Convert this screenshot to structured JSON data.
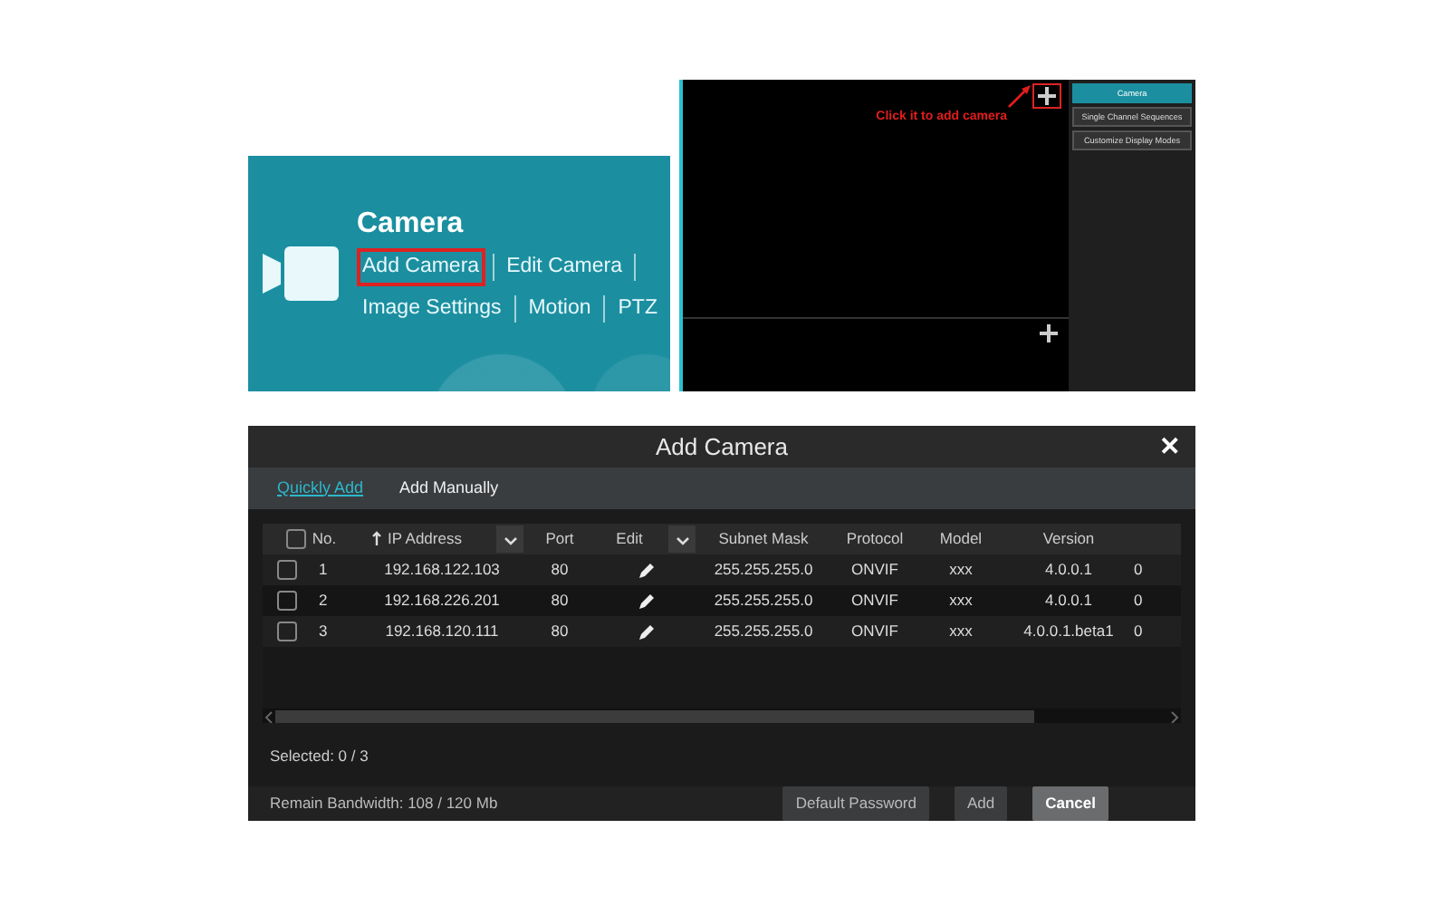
{
  "camera_tile": {
    "title": "Camera",
    "link_lines": [
      {
        "trailing_divider": true,
        "links": [
          {
            "label": "Add Camera",
            "highlighted": true
          },
          {
            "label": "Edit Camera",
            "highlighted": false
          }
        ]
      },
      {
        "trailing_divider": false,
        "links": [
          {
            "label": "Image Settings",
            "highlighted": false
          },
          {
            "label": "Motion",
            "highlighted": false
          },
          {
            "label": "PTZ",
            "highlighted": false
          }
        ]
      }
    ]
  },
  "preview": {
    "callout": "Click it to add camera",
    "sidebar": [
      {
        "label": "Camera",
        "selected": true
      },
      {
        "label": "Single Channel Sequences",
        "selected": false
      },
      {
        "label": "Customize Display Modes",
        "selected": false
      }
    ]
  },
  "dialog": {
    "title": "Add Camera",
    "close": "✕",
    "tabs": [
      {
        "label": "Quickly Add",
        "selected": true
      },
      {
        "label": "Add Manually",
        "selected": false
      }
    ],
    "table": {
      "select_all_checked": false,
      "columns": [
        {
          "label": "No.",
          "kind": "check"
        },
        {
          "label": "IP Address",
          "kind": "sorted-filter"
        },
        {
          "label": "Port",
          "kind": "plain"
        },
        {
          "label": "Edit",
          "kind": "filter"
        },
        {
          "label": "Subnet Mask",
          "kind": "plain"
        },
        {
          "label": "Protocol",
          "kind": "plain"
        },
        {
          "label": "Model",
          "kind": "plain"
        },
        {
          "label": "Version",
          "kind": "plain"
        }
      ],
      "rows": [
        {
          "checked": false,
          "no": "1",
          "ip": "192.168.122.103",
          "port": "80",
          "subnet": "255.255.255.0",
          "protocol": "ONVIF",
          "model": "xxx",
          "version": "4.0.0.1",
          "column_9": "0"
        },
        {
          "checked": false,
          "no": "2",
          "ip": "192.168.226.201",
          "port": "80",
          "subnet": "255.255.255.0",
          "protocol": "ONVIF",
          "model": "xxx",
          "version": "4.0.0.1",
          "column_9": "0"
        },
        {
          "checked": false,
          "no": "3",
          "ip": "192.168.120.111",
          "port": "80",
          "subnet": "255.255.255.0",
          "protocol": "ONVIF",
          "model": "xxx",
          "version": "4.0.0.1.beta1",
          "column_9": "0"
        }
      ]
    },
    "selected_count": "Selected: 0 / 3",
    "bandwidth": "Remain Bandwidth: 108 / 120 Mb",
    "buttons": [
      {
        "label": "Default Password",
        "emphasized": false
      },
      {
        "label": "Add",
        "emphasized": false
      },
      {
        "label": "Cancel",
        "emphasized": true
      }
    ]
  }
}
